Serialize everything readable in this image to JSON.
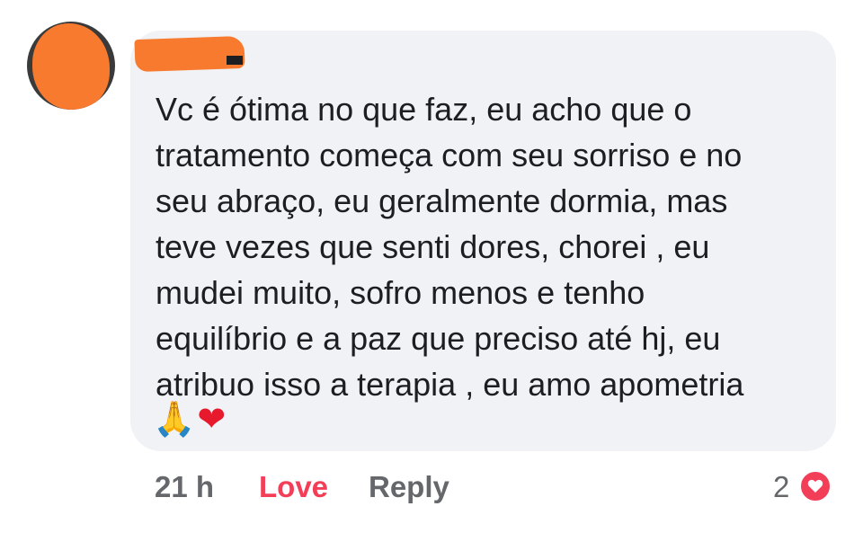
{
  "comment": {
    "text": "Vc é ótima no que faz, eu acho que o\ntratamento começa com seu sorriso e no\nseu abraço, eu geralmente dormia, mas\nteve vezes que senti dores, chorei , eu\nmudei muito, sofro menos e tenho\nequilíbrio e a paz que preciso até hj, eu\natribuo isso a terapia , eu amo apometria",
    "emojis": {
      "pray": "🙏",
      "heart": "❤"
    }
  },
  "footer": {
    "time": "21 h",
    "love_label": "Love",
    "reply_label": "Reply",
    "reaction_count": "2"
  },
  "colors": {
    "bubble_background": "#f0f2f5",
    "text": "#1c1e21",
    "meta_text": "#65676b",
    "love_accent": "#f33e58",
    "redaction": "#f77a2e"
  },
  "icons": {
    "reaction": "love-heart-icon"
  }
}
